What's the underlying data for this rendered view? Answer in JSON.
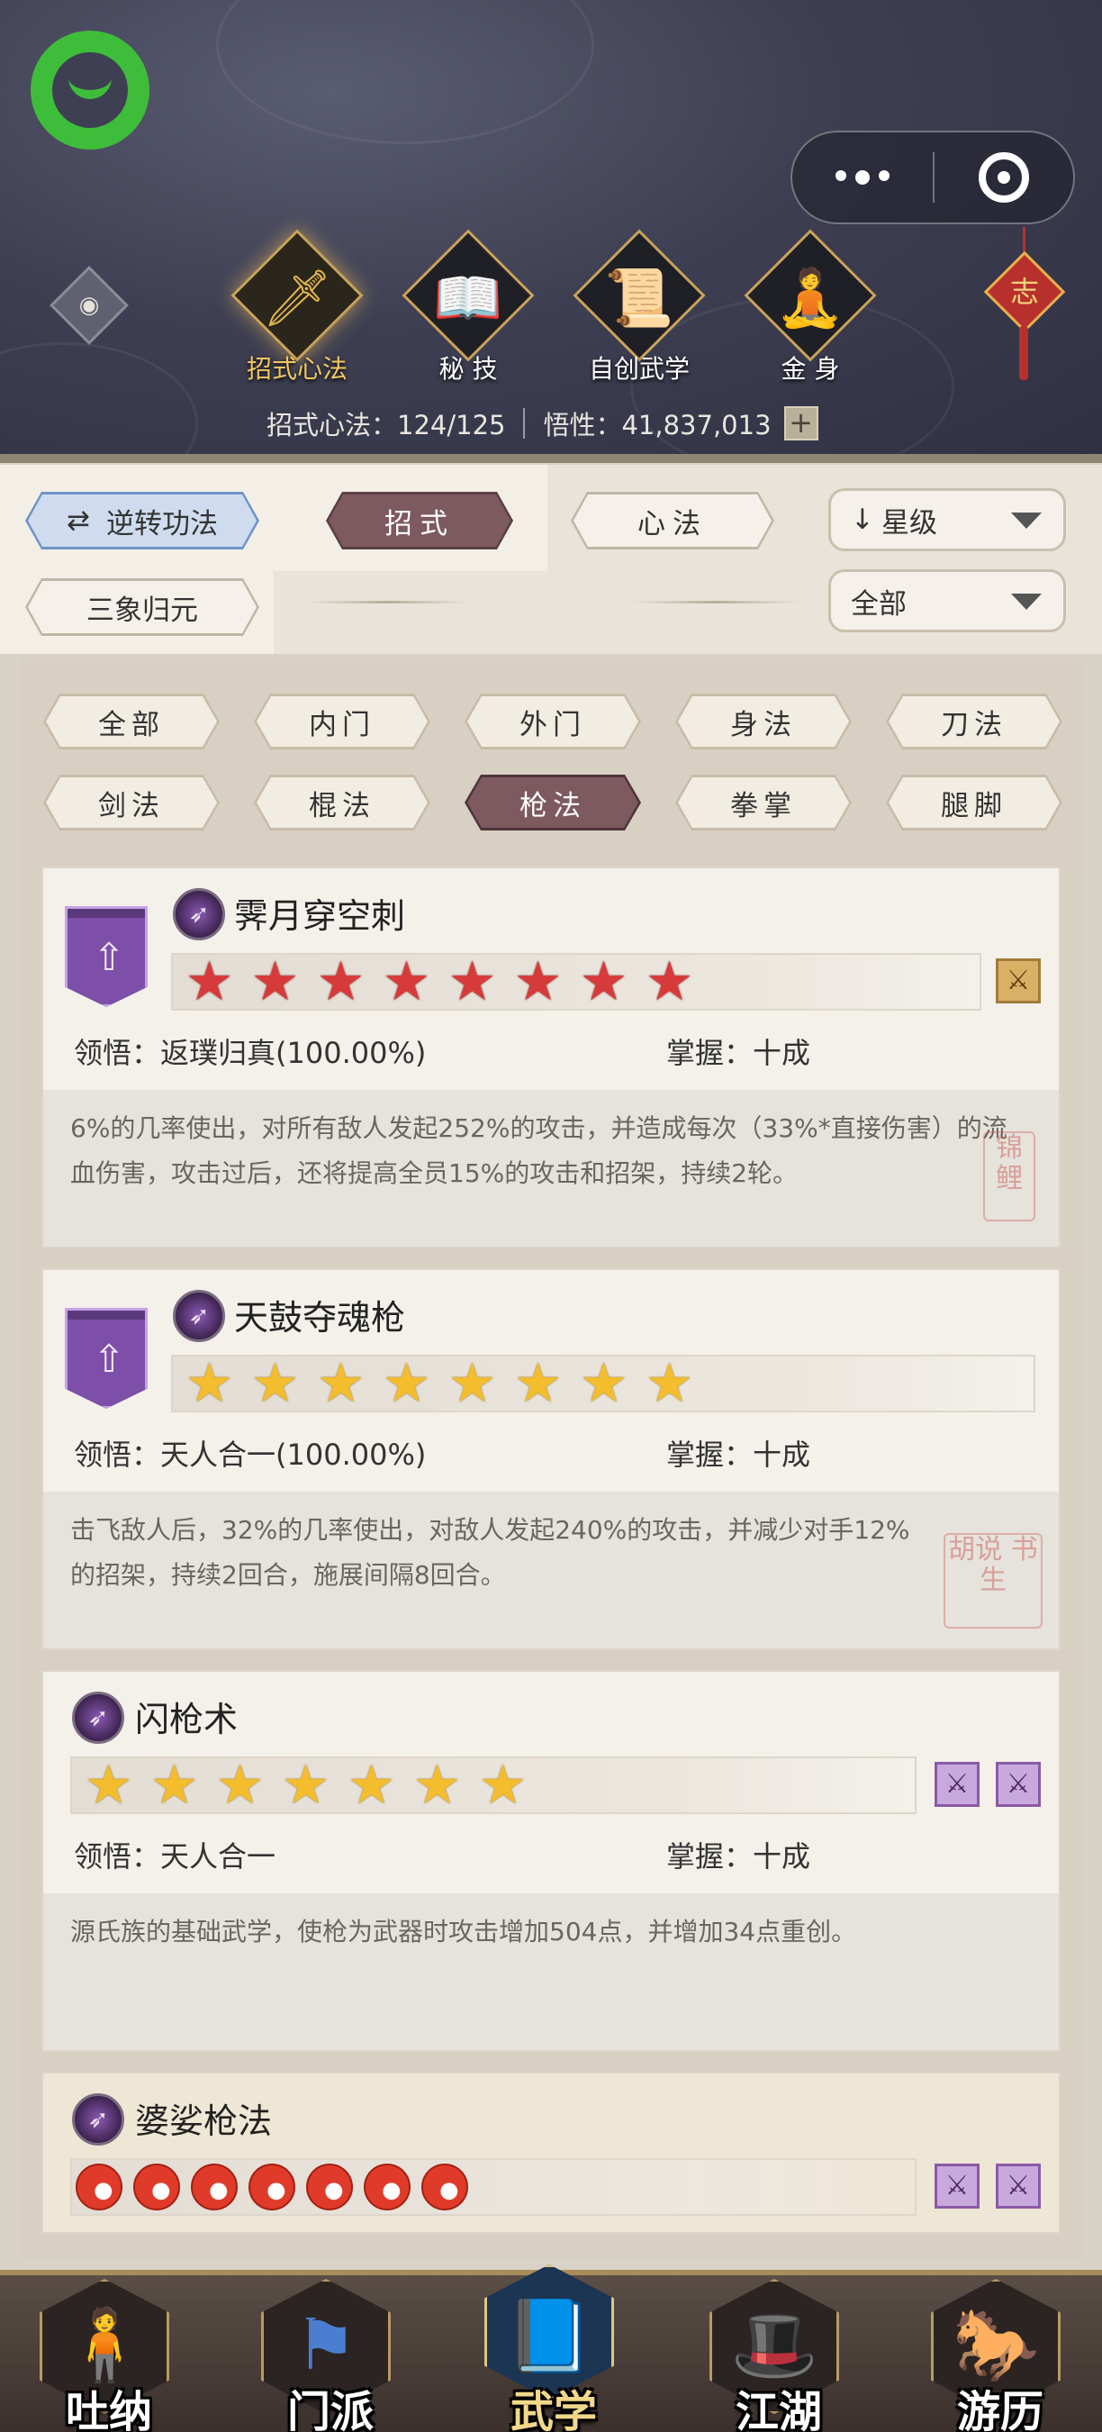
{
  "header": {
    "top_nav": [
      {
        "label": "招式心法",
        "icon": "sword-icon",
        "active": true
      },
      {
        "label": "秘 技",
        "icon": "book-icon",
        "active": false
      },
      {
        "label": "自创武学",
        "icon": "scroll-icon",
        "active": false
      },
      {
        "label": "金 身",
        "icon": "meditation-icon",
        "active": false
      }
    ],
    "ornament_char": "志",
    "stats": {
      "moves": "招式心法：124/125",
      "insight": "悟性：41,837,013"
    }
  },
  "tabs": {
    "reverse": "逆转功法",
    "moves": "招式",
    "mind": "心法",
    "sanxiang": "三象归元",
    "sort_select": "星级",
    "filter_select": "全部"
  },
  "categories": [
    "全部",
    "内门",
    "外门",
    "身法",
    "刀法",
    "剑法",
    "棍法",
    "枪法",
    "拳掌",
    "腿脚"
  ],
  "active_category": "枪法",
  "skills": [
    {
      "name": "霁月穿空刺",
      "stars": 8,
      "star_color": "red",
      "comprehension": "领悟：返璞归真(100.00%)",
      "mastery": "掌握：十成",
      "description": "6%的几率使出，对所有敌人发起252%的攻击，并造成每次（33%*直接伤害）的流血伤害，攻击过后，还将提高全员15%的攻击和招架，持续2轮。"
    },
    {
      "name": "天鼓夺魂枪",
      "stars": 8,
      "star_color": "gold",
      "comprehension": "领悟：天人合一(100.00%)",
      "mastery": "掌握：十成",
      "description": "击飞敌人后，32%的几率使出，对敌人发起240%的攻击，并减少对手12%的招架，持续2回合，施展间隔8回合。"
    },
    {
      "name": "闪枪术",
      "stars": 7,
      "star_color": "gold",
      "comprehension": "领悟：天人合一",
      "mastery": "掌握：十成",
      "description": "源氏族的基础武学，使枪为武器时攻击增加504点，并增加34点重创。"
    },
    {
      "name": "婆娑枪法",
      "stars": 7,
      "star_color": "flame"
    }
  ],
  "seals": [
    "锦鲤",
    "胡说 书生"
  ],
  "bottom_nav": [
    {
      "label": "吐纳",
      "icon": "monk-icon",
      "active": false
    },
    {
      "label": "门派",
      "icon": "sect-flag-icon",
      "active": false
    },
    {
      "label": "武学",
      "icon": "manual-book-icon",
      "active": true
    },
    {
      "label": "江湖",
      "icon": "straw-hat-icon",
      "active": false
    },
    {
      "label": "游历",
      "icon": "horse-icon",
      "active": false
    }
  ]
}
